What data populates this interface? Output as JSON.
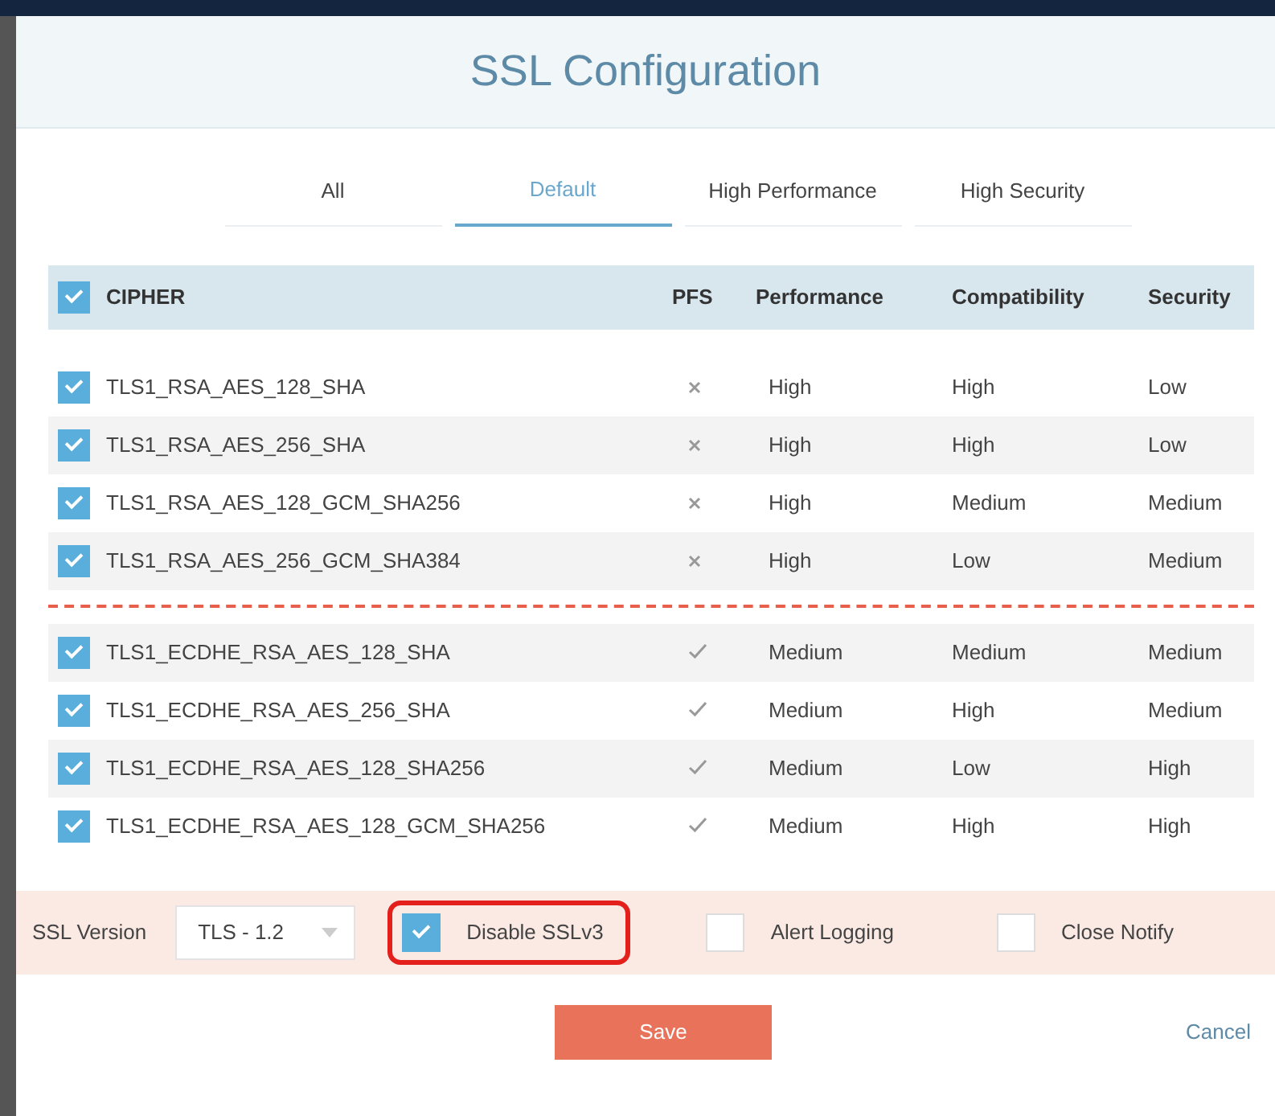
{
  "dialog": {
    "title": "SSL Configuration"
  },
  "tabs": [
    {
      "label": "All",
      "selected": false
    },
    {
      "label": "Default",
      "selected": true
    },
    {
      "label": "High Performance",
      "selected": false
    },
    {
      "label": "High Security",
      "selected": false
    }
  ],
  "table": {
    "select_all": {
      "checked": true
    },
    "columns": [
      "CIPHER",
      "PFS",
      "Performance",
      "Compatibility",
      "Security"
    ],
    "groups": [
      {
        "rows": [
          {
            "checked": true,
            "cipher": "TLS1_RSA_AES_128_SHA",
            "pfs": false,
            "performance": "High",
            "compatibility": "High",
            "security": "Low"
          },
          {
            "checked": true,
            "cipher": "TLS1_RSA_AES_256_SHA",
            "pfs": false,
            "performance": "High",
            "compatibility": "High",
            "security": "Low"
          },
          {
            "checked": true,
            "cipher": "TLS1_RSA_AES_128_GCM_SHA256",
            "pfs": false,
            "performance": "High",
            "compatibility": "Medium",
            "security": "Medium"
          },
          {
            "checked": true,
            "cipher": "TLS1_RSA_AES_256_GCM_SHA384",
            "pfs": false,
            "performance": "High",
            "compatibility": "Low",
            "security": "Medium"
          }
        ]
      },
      {
        "rows": [
          {
            "checked": true,
            "cipher": "TLS1_ECDHE_RSA_AES_128_SHA",
            "pfs": true,
            "performance": "Medium",
            "compatibility": "Medium",
            "security": "Medium"
          },
          {
            "checked": true,
            "cipher": "TLS1_ECDHE_RSA_AES_256_SHA",
            "pfs": true,
            "performance": "Medium",
            "compatibility": "High",
            "security": "Medium"
          },
          {
            "checked": true,
            "cipher": "TLS1_ECDHE_RSA_AES_128_SHA256",
            "pfs": true,
            "performance": "Medium",
            "compatibility": "Low",
            "security": "High"
          },
          {
            "checked": true,
            "cipher": "TLS1_ECDHE_RSA_AES_128_GCM_SHA256",
            "pfs": true,
            "performance": "Medium",
            "compatibility": "High",
            "security": "High"
          }
        ]
      }
    ]
  },
  "options": {
    "ssl_version": {
      "label": "SSL Version",
      "value": "TLS - 1.2"
    },
    "checkboxes": [
      {
        "label": "Disable SSLv3",
        "checked": true,
        "highlighted": true
      },
      {
        "label": "Alert Logging",
        "checked": false,
        "highlighted": false
      },
      {
        "label": "Close Notify",
        "checked": false,
        "highlighted": false
      }
    ]
  },
  "buttons": {
    "save": "Save",
    "cancel": "Cancel"
  }
}
